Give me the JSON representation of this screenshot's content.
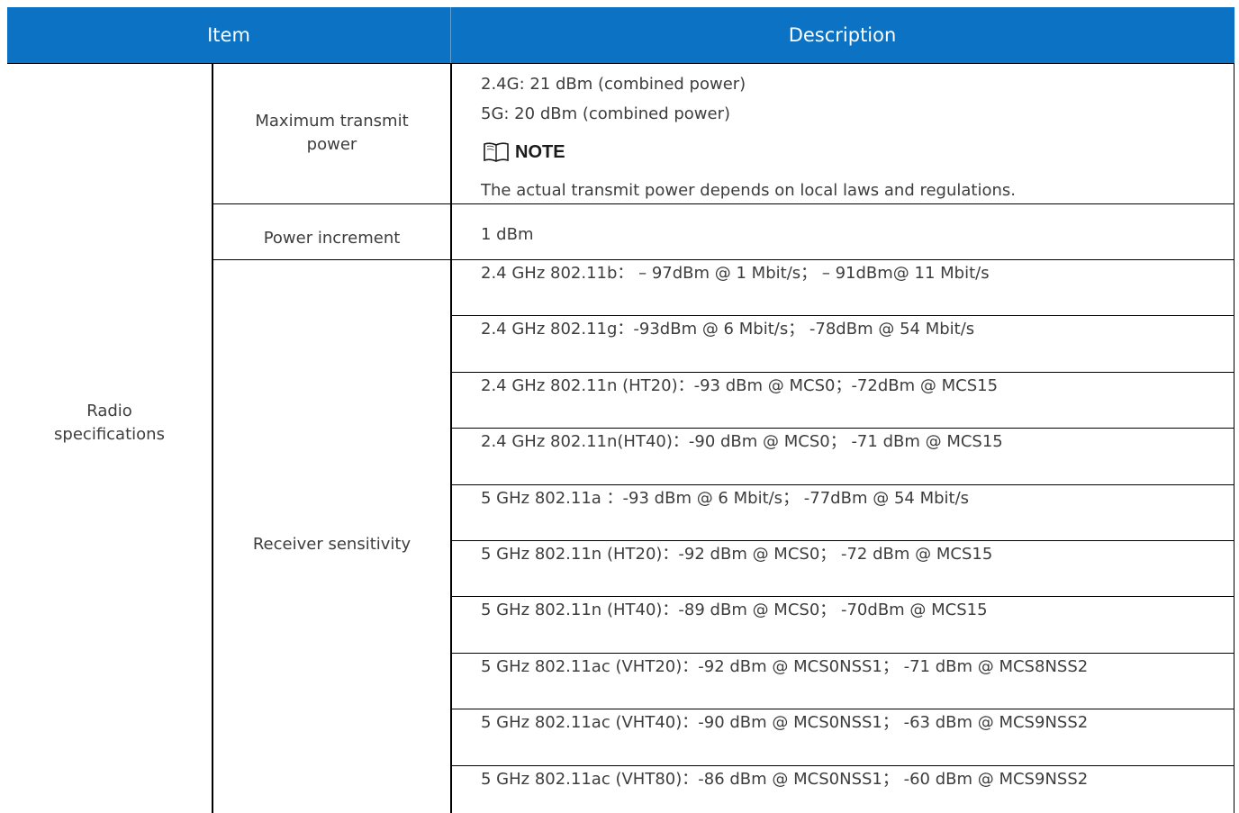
{
  "header": {
    "item": "Item",
    "description": "Description"
  },
  "category": "Radio\nspecifications",
  "rows": {
    "max_power": {
      "label": "Maximum transmit\npower",
      "lines": [
        "2.4G: 21 dBm (combined power)",
        "5G: 20 dBm (combined power)"
      ],
      "note_title": "NOTE",
      "note_text": "The actual transmit power depends on local laws and regulations."
    },
    "increment": {
      "label": "Power increment",
      "value": "1 dBm"
    },
    "sensitivity": {
      "label": "Receiver sensitivity",
      "lines": [
        "2.4 GHz  802.11b：  – 97dBm @ 1 Mbit/s；  – 91dBm@ 11 Mbit/s",
        "2.4 GHz  802.11g：-93dBm @ 6 Mbit/s；  -78dBm @ 54 Mbit/s",
        "2.4 GHz  802.11n (HT20)：-93 dBm @ MCS0；-72dBm @ MCS15",
        "2.4 GHz  802.11n(HT40)：-90 dBm @ MCS0；  -71 dBm @ MCS15",
        "5 GHz  802.11a ：-93 dBm @ 6 Mbit/s；  -77dBm @ 54 Mbit/s",
        "5 GHz  802.11n (HT20)：-92 dBm @ MCS0；  -72 dBm @ MCS15",
        "5 GHz  802.11n (HT40)：-89 dBm @ MCS0；  -70dBm @ MCS15",
        "5 GHz  802.11ac (VHT20)：-92 dBm @ MCS0NSS1；  -71 dBm @ MCS8NSS2",
        "5 GHz  802.11ac (VHT40)：-90 dBm @ MCS0NSS1；  -63 dBm @ MCS9NSS2",
        "5 GHz  802.11ac (VHT80)：-86 dBm @ MCS0NSS1；  -60 dBm @ MCS9NSS2"
      ]
    }
  },
  "icons": {
    "note": "open-book-icon"
  },
  "colors": {
    "header_bg": "#0b72c4",
    "header_text": "#ffffff"
  }
}
